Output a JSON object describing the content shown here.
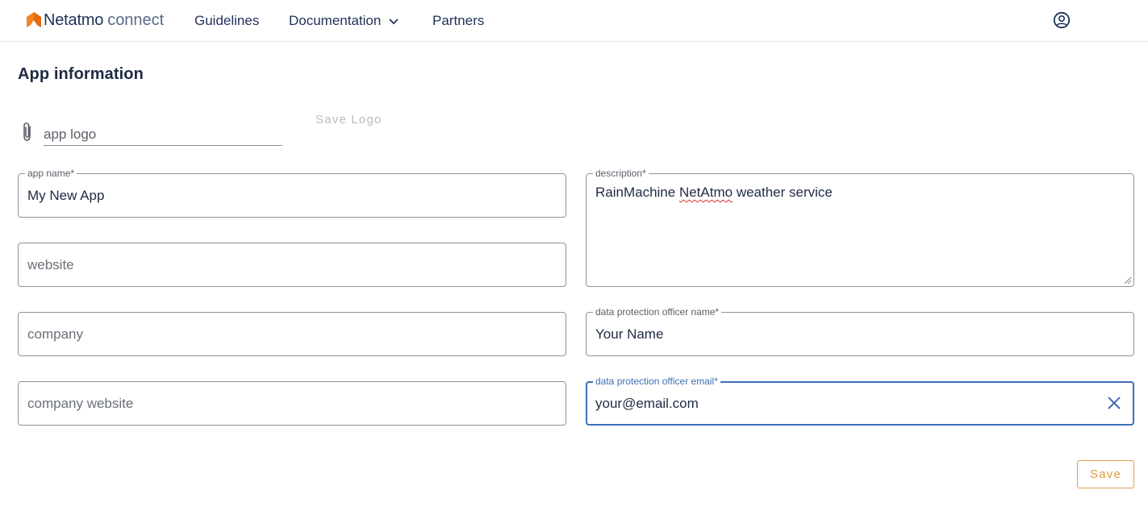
{
  "header": {
    "brand": "Netatmo",
    "brand_suffix": "connect",
    "brand_color": "#f58220",
    "nav": {
      "guidelines": "Guidelines",
      "documentation": "Documentation",
      "partners": "Partners"
    },
    "icons": {
      "dropdown": "chevron-down-icon",
      "account": "account-circle-icon"
    }
  },
  "page": {
    "title": "App information"
  },
  "logo_upload": {
    "icon": "paperclip-icon",
    "placeholder": "app logo",
    "save_label": "Save Logo"
  },
  "form": {
    "app_name": {
      "label": "app name*",
      "value": "My New App"
    },
    "website": {
      "placeholder": "website",
      "value": ""
    },
    "company": {
      "placeholder": "company",
      "value": ""
    },
    "company_website": {
      "placeholder": "company website",
      "value": ""
    },
    "description": {
      "label": "description*",
      "value_part1": "RainMachine ",
      "value_misspelled": "NetAtmo",
      "value_part2": " weather service"
    },
    "dpo_name": {
      "label": "data protection officer name*",
      "value": "Your Name"
    },
    "dpo_email": {
      "label": "data protection officer email*",
      "value": "your@email.com",
      "clear_icon": "close-icon"
    }
  },
  "actions": {
    "save_label": "Save",
    "accent_color": "#e09a40",
    "focus_color": "#3f6fb5"
  }
}
